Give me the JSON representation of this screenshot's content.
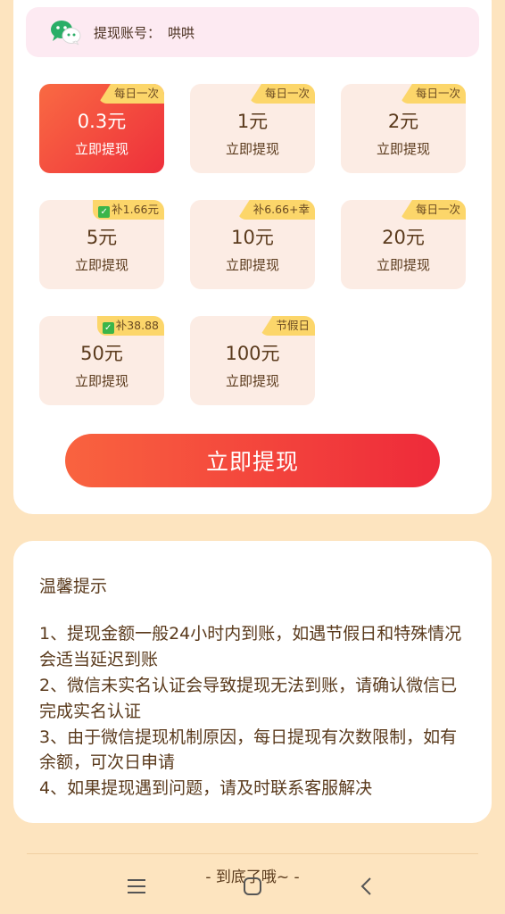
{
  "account": {
    "label": "提现账号：",
    "value": "哄哄"
  },
  "options": [
    {
      "amount": "0.3元",
      "action": "立即提现",
      "badge": "每日一次",
      "checked": false,
      "active": true
    },
    {
      "amount": "1元",
      "action": "立即提现",
      "badge": "每日一次",
      "checked": false,
      "active": false
    },
    {
      "amount": "2元",
      "action": "立即提现",
      "badge": "每日一次",
      "checked": false,
      "active": false
    },
    {
      "amount": "5元",
      "action": "立即提现",
      "badge": "补1.66元",
      "checked": true,
      "active": false
    },
    {
      "amount": "10元",
      "action": "立即提现",
      "badge": "补6.66+幸",
      "checked": false,
      "active": false
    },
    {
      "amount": "20元",
      "action": "立即提现",
      "badge": "每日一次",
      "checked": false,
      "active": false
    },
    {
      "amount": "50元",
      "action": "立即提现",
      "badge": "补38.88",
      "checked": true,
      "active": false
    },
    {
      "amount": "100元",
      "action": "立即提现",
      "badge": "节假日",
      "checked": false,
      "active": false
    }
  ],
  "withdraw_button": "立即提现",
  "tips": {
    "title": "温馨提示",
    "items": [
      "1、提现金额一般24小时内到账，如遇节假日和特殊情况会适当延迟到账",
      "2、微信未实名认证会导致提现无法到账，请确认微信已完成实名认证",
      "3、由于微信提现机制原因，每日提现有次数限制，如有余额，可次日申请",
      "4、如果提现遇到问题，请及时联系客服解决"
    ]
  },
  "footer": "- 到底了哦~ -",
  "nav_icons": [
    "menu-icon",
    "home-icon",
    "back-icon"
  ],
  "colors": {
    "accent": "#ee2f3b",
    "accent_start": "#f96a43",
    "badge": "#fcd66a",
    "page_bg": "#fde4bf"
  }
}
